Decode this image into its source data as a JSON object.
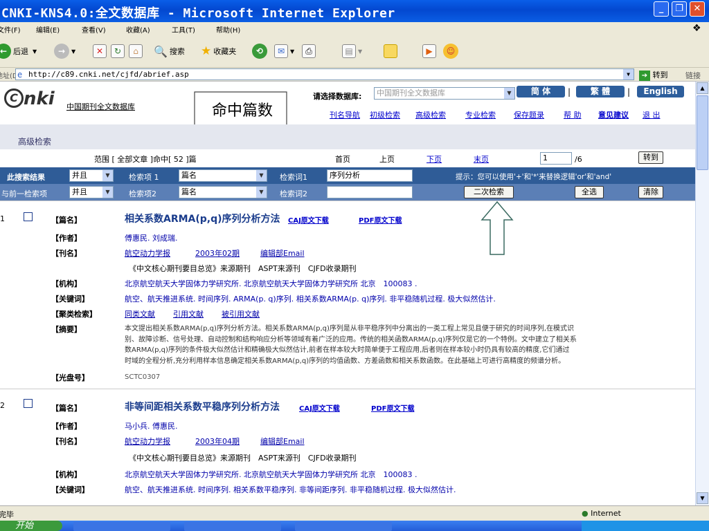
{
  "window": {
    "title": "CNKI-KNS4.0:全文数据库 - Microsoft Internet Explorer"
  },
  "menu": [
    "文件(F)",
    "编辑(E)",
    "查看(V)",
    "收藏(A)",
    "工具(T)",
    "帮助(H)"
  ],
  "toolbar": {
    "back": "后退",
    "search": "搜索",
    "favorites": "收藏夹"
  },
  "address": {
    "label": "地址(D)",
    "url": "http://c89.cnki.net/cjfd/abrief.asp",
    "go": "转到",
    "links": "链接"
  },
  "header": {
    "logo": "nki",
    "db_name": "中国期刊全文数据库",
    "callout": "命中篇数",
    "choose_db_label": "请选择数据库:",
    "choose_db_value": "中国期刊全文数据库",
    "lang_simplified": "简 体",
    "lang_traditional": "繁 體",
    "lang_english": "English",
    "nav": [
      "刊名导航",
      "初级检索",
      "高级检索",
      "专业检索",
      "保存题录",
      "帮 助",
      "意见建议",
      "退 出"
    ],
    "adv_search": "高级检索"
  },
  "pager": {
    "range_text": "范围 [ 全部文章 ]命中[ 52 ]篇",
    "first": "首页",
    "prev": "上页",
    "next": "下页",
    "last": "末页",
    "page_value": "1",
    "total": "/6",
    "goto": "转到"
  },
  "search": {
    "row1_label": "此搜索结果",
    "row1_logic": "并且",
    "row1_field_label": "检索项 1",
    "row1_field": "篇名",
    "row1_term_label": "检索词1",
    "row1_term": "序列分析",
    "hint": "提示：您可以使用'+'和'*'来替换逻辑'or'和'and'",
    "row2_label": "与前一检索项",
    "row2_logic": "并且",
    "row2_field_label": "检索项2",
    "row2_field": "篇名",
    "row2_term_label": "检索词2",
    "row2_term": "",
    "secondary_search": "二次检索",
    "select_all": "全选",
    "clear": "清除"
  },
  "results": [
    {
      "num": "1",
      "title_label": "【篇名】",
      "title": "相关系数ARMA(p,q)序列分析方法",
      "caj": "CAJ原文下载",
      "pdf": "PDF原文下载",
      "author_label": "【作者】",
      "author": "傅惠民. 刘成瑞.",
      "journal_label": "【刊名】",
      "journal": "航空动力学报",
      "issue": "2003年02期",
      "email": "编辑部Email",
      "index_note": "《中文核心期刊要目总览》来源期刊　ASPT来源刊　CJFD收录期刊",
      "org_label": "【机构】",
      "org": "北京航空航天大学固体力学研究所. 北京航空航天大学固体力学研究所 北京　100083 .",
      "kw_label": "【关键词】",
      "kw": "航空、航天推进系统. 时间序列. ARMA(p. q)序列. 相关系数ARMA(p. q)序列. 非平稳随机过程. 极大似然估计.",
      "cluster_label": "【聚类检索】",
      "cluster": [
        "同类文献",
        "引用文献",
        "被引用文献"
      ],
      "abstract_label": "【摘要】",
      "abstract": [
        "本文提出相关系数ARMA(p,q)序列分析方法。相关系数ARMA(p,q)序列是从非平稳序列中分离出的一类工程上常见且便于研究的时间序列,在模式识",
        "别、故障诊断、信号处理、自动控制和结构响应分析等领域有着广泛的应用。传统的相关函数ARMA(p,q)序列仅是它的一个特例。文中建立了相关系",
        "数ARMA(p,q)序列的条件极大似然估计和精确极大似然估计,前者在样本较大时简单便于工程应用,后者则在样本较小时仍具有较高的精度,它们通过",
        "时域的全程分析,充分利用样本信息确定相关系数ARMA(p,q)序列的均值函数、方差函数和相关系数函数。在此基础上可进行高精度的频谱分析。"
      ],
      "disc_label": "【光盘号】",
      "disc": "SCTC0307"
    },
    {
      "num": "2",
      "title_label": "【篇名】",
      "title": "非等间距相关系数平稳序列分析方法",
      "caj": "CAJ原文下载",
      "pdf": "PDF原文下载",
      "author_label": "【作者】",
      "author": "马小兵. 傅惠民.",
      "journal_label": "【刊名】",
      "journal": "航空动力学报",
      "issue": "2003年04期",
      "email": "编辑部Email",
      "index_note": "《中文核心期刊要目总览》来源期刊　ASPT来源刊　CJFD收录期刊",
      "org_label": "【机构】",
      "org": "北京航空航天大学固体力学研究所. 北京航空航天大学固体力学研究所 北京　100083 .",
      "kw_label": "【关键词】",
      "kw": "航空、航天推进系统. 时间序列. 相关系数平稳序列. 非等间距序列. 非平稳随机过程. 极大似然估计."
    }
  ],
  "status": {
    "left": "完毕",
    "zone": "Internet"
  },
  "taskbar": {
    "start": "开始"
  }
}
